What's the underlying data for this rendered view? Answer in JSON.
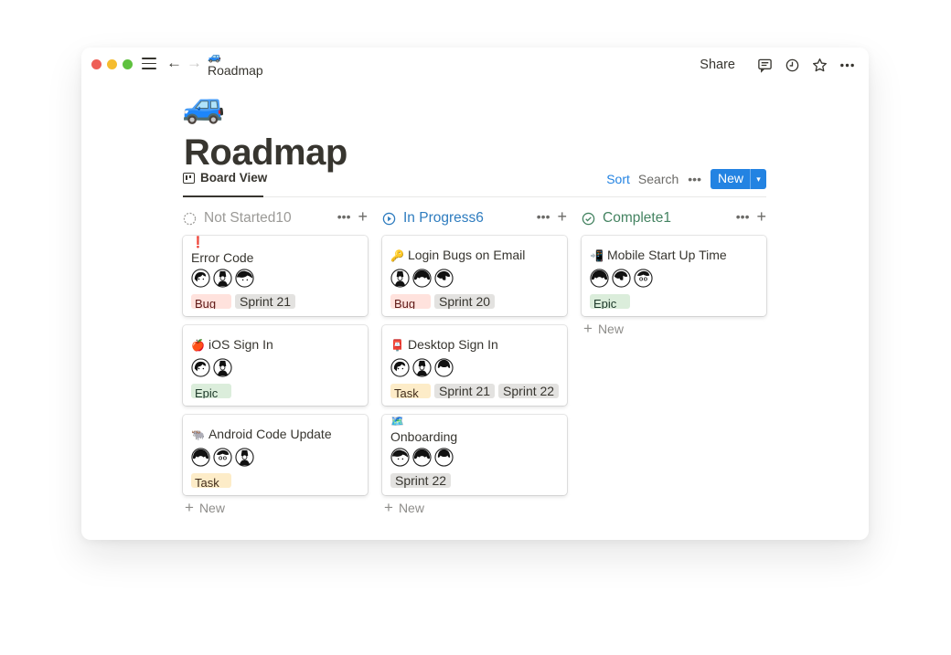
{
  "topbar": {
    "breadcrumb_icon": "🚙",
    "breadcrumb_label": "Roadmap",
    "share_label": "Share",
    "icons": [
      "comment-icon",
      "clock-icon",
      "star-icon",
      "more-icon"
    ]
  },
  "page": {
    "emoji": "🚙",
    "title": "Roadmap"
  },
  "view": {
    "tab_label": "Board View",
    "sort_label": "Sort",
    "search_label": "Search",
    "more_label": "•••",
    "new_label": "New"
  },
  "columns": [
    {
      "title": "Not Started",
      "count": "10",
      "status_color": "#9b9a97",
      "more_label": "•••",
      "add_label": "+",
      "new_label": "New",
      "cards": [
        {
          "emoji": "❗",
          "title": "Error Code",
          "tags": [
            {
              "label": "Bug",
              "kind": "bug"
            },
            {
              "label": "Sprint 21",
              "kind": "sprint"
            }
          ]
        },
        {
          "emoji": "🍎",
          "title": "iOS Sign In",
          "tags": [
            {
              "label": "Epic",
              "kind": "epic"
            }
          ]
        },
        {
          "emoji": "🐃",
          "title": "Android Code Update",
          "tags": [
            {
              "label": "Task",
              "kind": "task"
            }
          ]
        }
      ]
    },
    {
      "title": "In Progress",
      "count": "6",
      "status_color": "#2e7cbf",
      "more_label": "•••",
      "add_label": "+",
      "new_label": "New",
      "cards": [
        {
          "emoji": "🔑",
          "title": "Login Bugs on Email",
          "tags": [
            {
              "label": "Bug",
              "kind": "bug"
            },
            {
              "label": "Sprint 20",
              "kind": "sprint"
            }
          ]
        },
        {
          "emoji": "📮",
          "title": "Desktop Sign In",
          "tags": [
            {
              "label": "Task",
              "kind": "task"
            },
            {
              "label": "Sprint 21",
              "kind": "sprint"
            },
            {
              "label": "Sprint 22",
              "kind": "sprint"
            }
          ]
        },
        {
          "emoji": "🗺️",
          "title": "Onboarding",
          "tags": [
            {
              "label": "Sprint 22",
              "kind": "sprint"
            }
          ]
        }
      ]
    },
    {
      "title": "Complete",
      "count": "1",
      "status_color": "#448361",
      "more_label": "•••",
      "add_label": "+",
      "new_label": "New",
      "cards": [
        {
          "emoji": "📲",
          "title": "Mobile Start Up Time",
          "tags": [
            {
              "label": "Epic",
              "kind": "epic"
            }
          ]
        }
      ]
    }
  ]
}
